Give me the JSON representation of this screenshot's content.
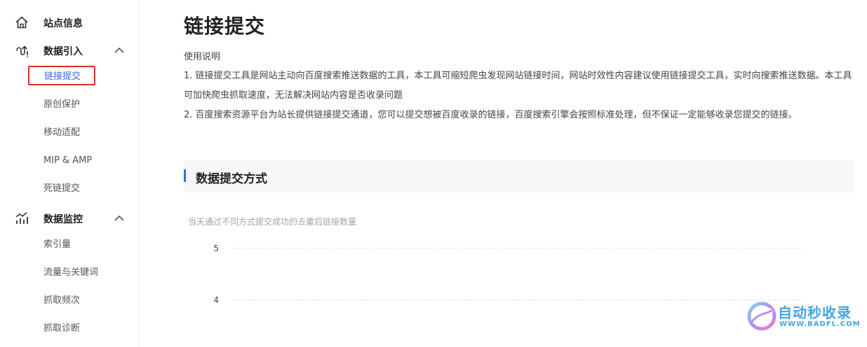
{
  "sidebar": {
    "site_info": {
      "label": "站点信息",
      "icon": "home-icon"
    },
    "data_import": {
      "label": "数据引入",
      "icon": "data-import-icon",
      "items": [
        {
          "label": "链接提交",
          "active": true
        },
        {
          "label": "原创保护"
        },
        {
          "label": "移动适配"
        },
        {
          "label": "MIP & AMP"
        },
        {
          "label": "死链提交"
        }
      ]
    },
    "data_monitor": {
      "label": "数据监控",
      "icon": "chart-icon",
      "items": [
        {
          "label": "索引量"
        },
        {
          "label": "流量与关键词"
        },
        {
          "label": "抓取频次"
        },
        {
          "label": "抓取诊断"
        }
      ]
    }
  },
  "main": {
    "title": "链接提交",
    "usage_title": "使用说明",
    "paragraph1": "1. 链接提交工具是网站主动向百度搜索推送数据的工具，本工具可缩短爬虫发现网站链接时间，网站时效性内容建议使用链接提交工具，实时向搜索推送数据。本工具可加快爬虫抓取速度，无法解决网站内容是否收录问题",
    "paragraph2": "2. 百度搜索资源平台为站长提供链接提交通道，您可以提交想被百度收录的链接，百度搜索引擎会按照标准处理，但不保证一定能够收录您提交的链接。",
    "section_title": "数据提交方式"
  },
  "chart_data": {
    "type": "line",
    "title": "当天通过不同方式提交成功的去重后链接数量",
    "y_ticks": [
      "5",
      "4"
    ],
    "ylim": [
      4,
      5
    ],
    "grid": true
  },
  "watermark": {
    "text": "自动秒收录",
    "url": "WWW.BADFL.COM",
    "accent": "#45a5e0"
  },
  "colors": {
    "accent": "#3a6bd9",
    "highlight_border": "#d9302a"
  }
}
